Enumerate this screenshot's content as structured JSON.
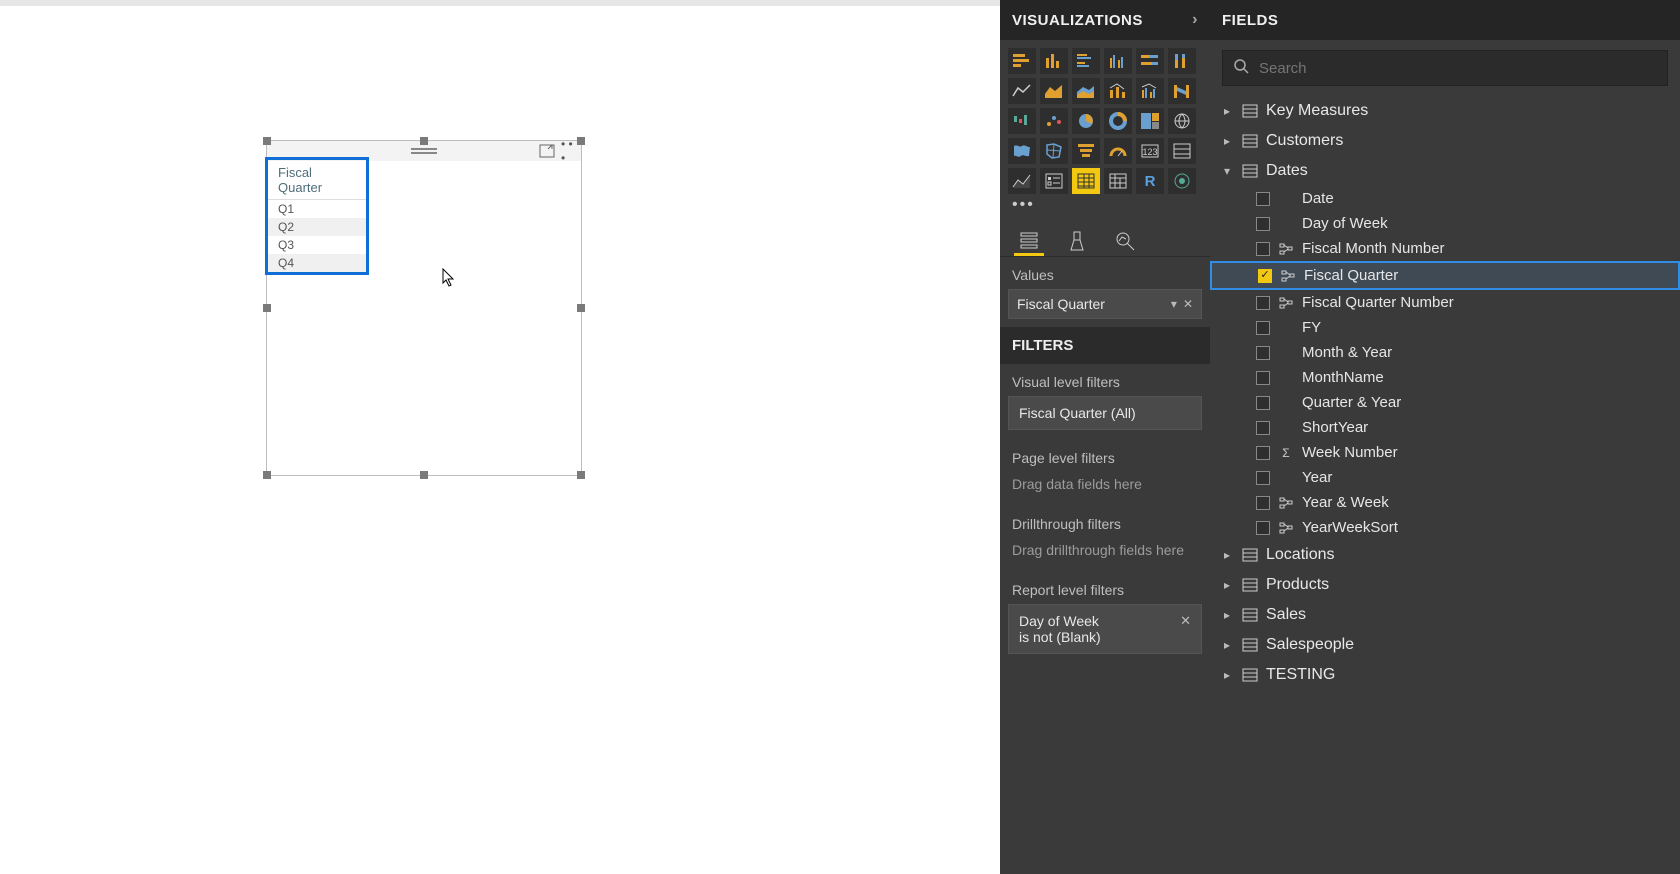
{
  "panels": {
    "visualizations": {
      "title": "VISUALIZATIONS"
    },
    "fields": {
      "title": "FIELDS"
    }
  },
  "search": {
    "placeholder": "Search"
  },
  "canvas": {
    "table": {
      "header": "Fiscal Quarter",
      "rows": [
        "Q1",
        "Q2",
        "Q3",
        "Q4"
      ]
    }
  },
  "viz": {
    "tabs": {
      "values_label": "Values"
    },
    "well": {
      "field": "Fiscal Quarter"
    }
  },
  "filters": {
    "title": "FILTERS",
    "visual_label": "Visual level filters",
    "visual_card": "Fiscal Quarter (All)",
    "page_label": "Page level filters",
    "page_hint": "Drag data fields here",
    "drill_label": "Drillthrough filters",
    "drill_hint": "Drag drillthrough fields here",
    "report_label": "Report level filters",
    "report_card_line1": "Day of Week",
    "report_card_line2": "is not (Blank)"
  },
  "tables": [
    {
      "name": "Key Measures",
      "expanded": false
    },
    {
      "name": "Customers",
      "expanded": false
    },
    {
      "name": "Dates",
      "expanded": true,
      "fields": [
        {
          "name": "Date",
          "checked": false,
          "icon": "none"
        },
        {
          "name": "Day of Week",
          "checked": false,
          "icon": "none"
        },
        {
          "name": "Fiscal Month Number",
          "checked": false,
          "icon": "hier"
        },
        {
          "name": "Fiscal Quarter",
          "checked": true,
          "icon": "hier",
          "highlight": true
        },
        {
          "name": "Fiscal Quarter Number",
          "checked": false,
          "icon": "hier"
        },
        {
          "name": "FY",
          "checked": false,
          "icon": "none"
        },
        {
          "name": "Month & Year",
          "checked": false,
          "icon": "none"
        },
        {
          "name": "MonthName",
          "checked": false,
          "icon": "none"
        },
        {
          "name": "Quarter & Year",
          "checked": false,
          "icon": "none"
        },
        {
          "name": "ShortYear",
          "checked": false,
          "icon": "none"
        },
        {
          "name": "Week Number",
          "checked": false,
          "icon": "sigma"
        },
        {
          "name": "Year",
          "checked": false,
          "icon": "none"
        },
        {
          "name": "Year & Week",
          "checked": false,
          "icon": "hier"
        },
        {
          "name": "YearWeekSort",
          "checked": false,
          "icon": "hier"
        }
      ]
    },
    {
      "name": "Locations",
      "expanded": false
    },
    {
      "name": "Products",
      "expanded": false
    },
    {
      "name": "Sales",
      "expanded": false
    },
    {
      "name": "Salespeople",
      "expanded": false
    },
    {
      "name": "TESTING",
      "expanded": false
    }
  ]
}
